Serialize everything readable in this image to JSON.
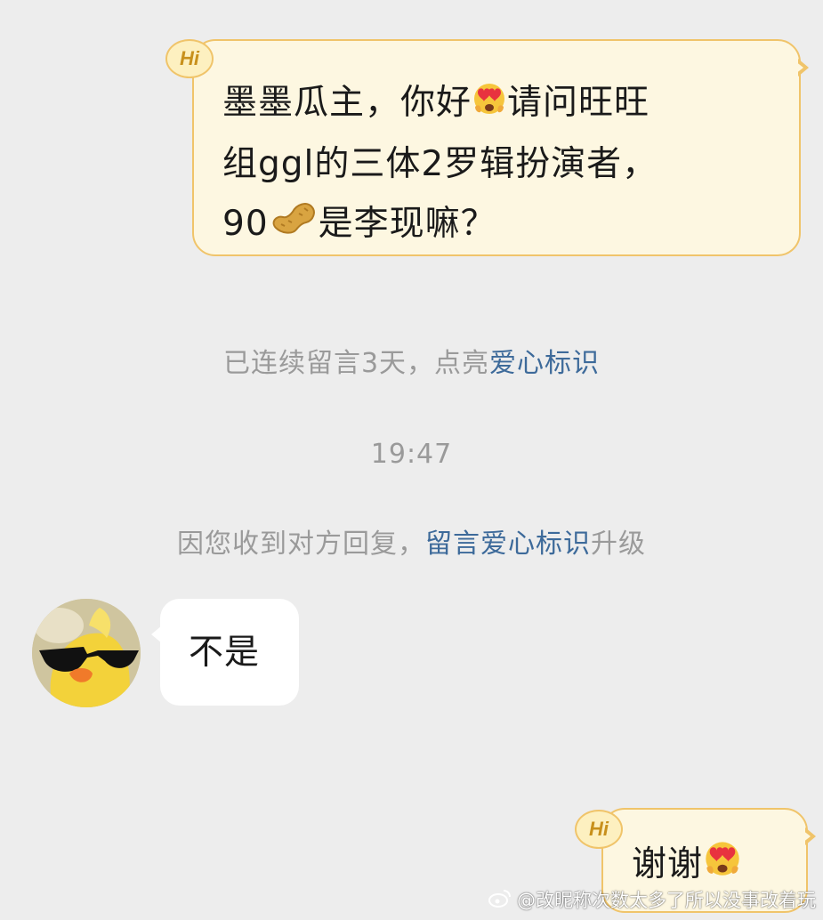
{
  "messages": {
    "first": {
      "badge": "Hi",
      "line1": "墨墨瓜主，你好",
      "line1b": "请问旺旺",
      "line2": "组ggl的三体2罗辑扮演者，",
      "line3a": "90",
      "line3b": "是李现嘛？"
    },
    "reply": {
      "text": "不是"
    },
    "last": {
      "badge": "Hi",
      "text": "谢谢"
    }
  },
  "system": {
    "streak_text": "已连续留言3天，点亮",
    "streak_link": "爱心标识",
    "timestamp": "19:47",
    "upgrade_text": "因您收到对方回复，",
    "upgrade_link": "留言爱心标识",
    "upgrade_suffix": "升级"
  },
  "watermark": {
    "text": "@改昵称次数太多了所以没事改着玩"
  },
  "icons": {
    "badge": "hi-badge-icon",
    "heart_eyes": "heart-eyes-emoji",
    "peanut": "peanut-emoji",
    "weibo": "weibo-logo-icon"
  }
}
